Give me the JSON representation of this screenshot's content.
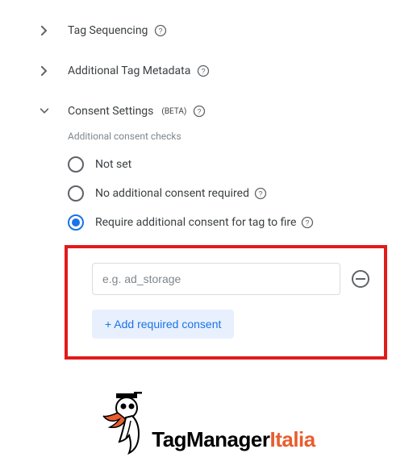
{
  "sections": {
    "tag_sequencing": "Tag Sequencing",
    "additional_metadata": "Additional Tag Metadata",
    "consent_settings": "Consent Settings",
    "beta_label": "(BETA)"
  },
  "consent": {
    "subheader": "Additional consent checks",
    "options": {
      "not_set": "Not set",
      "no_additional": "No additional consent required",
      "require_additional": "Require additional consent for tag to fire"
    },
    "input_placeholder": "e.g. ad_storage",
    "input_value": "",
    "add_button": "+ Add required consent"
  },
  "brand": {
    "part1": "TagManager",
    "part2": "Italia"
  }
}
